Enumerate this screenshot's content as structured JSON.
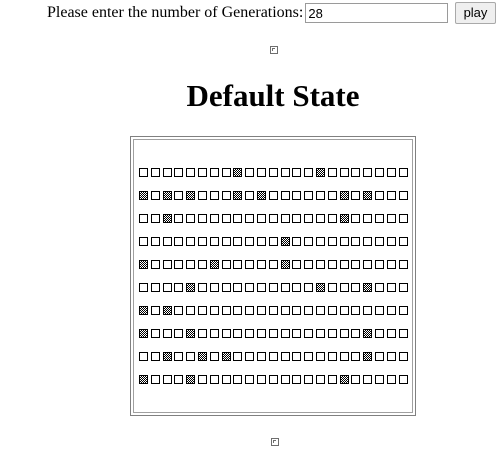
{
  "controls": {
    "prompt_label": "Please enter the number of Generations:",
    "generations_value": "28",
    "play_label": "play"
  },
  "main": {
    "title": "Default State"
  },
  "grid": {
    "rows": 10,
    "columns": 23,
    "cells": [
      "........#......#.......",
      "#.#.#...#.#......#.#...",
      "..#..............#.....",
      "............#..........",
      "#.....#.....#..........",
      "....#..........#...#...",
      "#.#....................",
      "#...#..............#...",
      "..#..#.#...........#...",
      "#...#............#....."
    ]
  }
}
